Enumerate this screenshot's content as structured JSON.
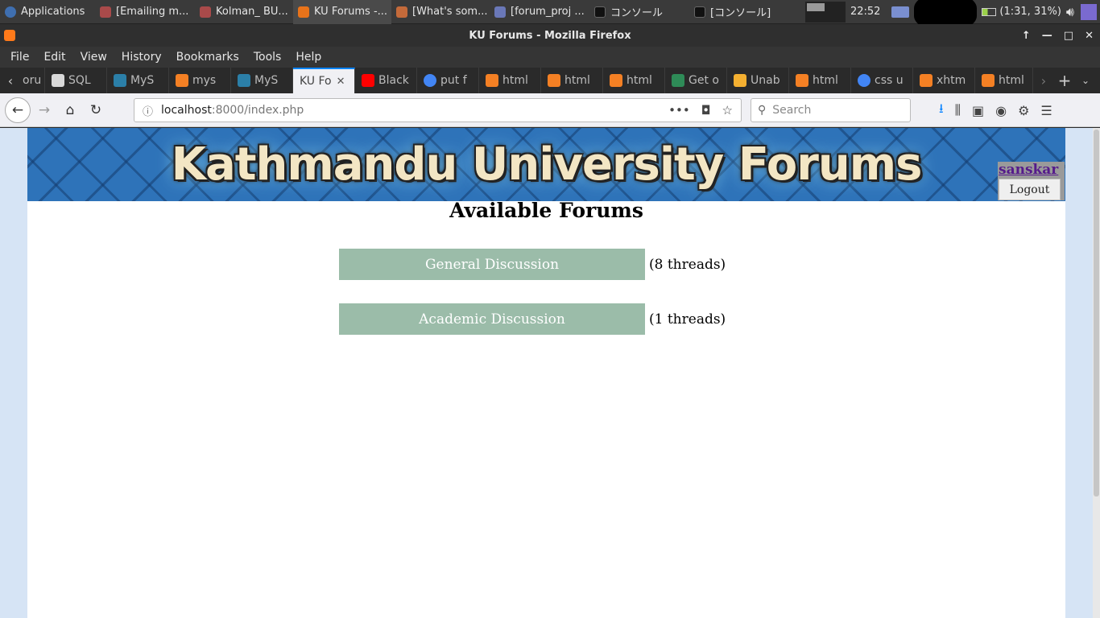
{
  "taskbar": {
    "apps": [
      {
        "label": "Applications",
        "color": "#3f6fb0"
      },
      {
        "label": "[Emailing m...",
        "color": "#a94a4a"
      },
      {
        "label": "Kolman_ BU...",
        "color": "#a94a4a"
      },
      {
        "label": "KU Forums -...",
        "color": "#e8731a"
      },
      {
        "label": "[What's som...",
        "color": "#c46a3a"
      },
      {
        "label": "[forum_proj ...",
        "color": "#6a78b8"
      },
      {
        "label": "コンソール",
        "color": "#222222"
      },
      {
        "label": "[コンソール]",
        "color": "#222222"
      }
    ],
    "clock": "22:52",
    "battery": "(1:31, 31%)"
  },
  "window": {
    "title": "KU Forums - Mozilla Firefox"
  },
  "menu": [
    "File",
    "Edit",
    "View",
    "History",
    "Bookmarks",
    "Tools",
    "Help"
  ],
  "tabs": [
    {
      "label": "oru",
      "color": "#555555"
    },
    {
      "label": "SQL",
      "color": "#d9d9d9"
    },
    {
      "label": "MyS",
      "color": "#2b7fa8"
    },
    {
      "label": "mys",
      "color": "#f48024"
    },
    {
      "label": "MyS",
      "color": "#2b7fa8"
    },
    {
      "label": "KU Fo",
      "color": "#e8731a",
      "active": true
    },
    {
      "label": "Black",
      "color": "#ff0000"
    },
    {
      "label": "put f",
      "color": "#4285f4"
    },
    {
      "label": "html",
      "color": "#f48024"
    },
    {
      "label": "html",
      "color": "#f48024"
    },
    {
      "label": "html",
      "color": "#f48024"
    },
    {
      "label": "Get o",
      "color": "#2e8b57"
    },
    {
      "label": "Unab",
      "color": "#f5b031"
    },
    {
      "label": "html",
      "color": "#f48024"
    },
    {
      "label": "css u",
      "color": "#4285f4"
    },
    {
      "label": "xhtm",
      "color": "#f48024"
    },
    {
      "label": "html",
      "color": "#f48024"
    }
  ],
  "navbar": {
    "url_host": "localhost",
    "url_path": ":8000/index.php",
    "search_placeholder": "Search"
  },
  "page": {
    "banner_title": "Kathmandu University Forums",
    "username": "sanskar",
    "logout_label": "Logout",
    "heading": "Available Forums",
    "forums": [
      {
        "name": "General Discussion",
        "count": "(8 threads)"
      },
      {
        "name": "Academic Discussion",
        "count": "(1 threads)"
      }
    ]
  }
}
